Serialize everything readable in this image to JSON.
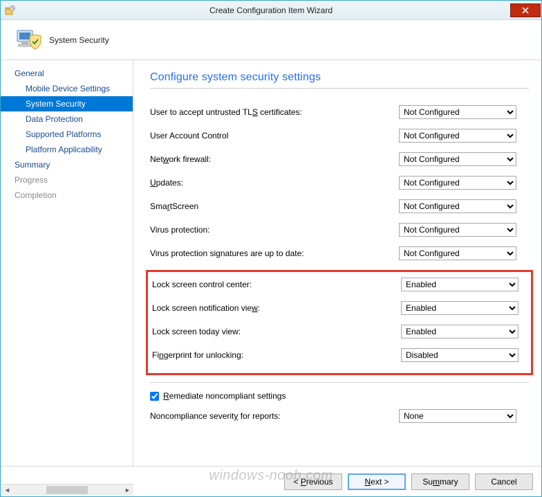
{
  "window": {
    "title": "Create Configuration Item Wizard"
  },
  "header": {
    "label": "System Security"
  },
  "sidebar": {
    "items": [
      {
        "label": "General",
        "level": 1,
        "selected": false,
        "muted": false
      },
      {
        "label": "Mobile Device Settings",
        "level": 2,
        "selected": false,
        "muted": false
      },
      {
        "label": "System Security",
        "level": 2,
        "selected": true,
        "muted": false
      },
      {
        "label": "Data Protection",
        "level": 2,
        "selected": false,
        "muted": false
      },
      {
        "label": "Supported Platforms",
        "level": 2,
        "selected": false,
        "muted": false
      },
      {
        "label": "Platform Applicability",
        "level": 2,
        "selected": false,
        "muted": false
      },
      {
        "label": "Summary",
        "level": 1,
        "selected": false,
        "muted": false
      },
      {
        "label": "Progress",
        "level": 1,
        "selected": false,
        "muted": true
      },
      {
        "label": "Completion",
        "level": 1,
        "selected": false,
        "muted": true
      }
    ]
  },
  "content": {
    "heading": "Configure system security settings",
    "settings_top": [
      {
        "label_html": "User to accept untrusted TL<u>S</u> certificates:",
        "value": "Not Configured"
      },
      {
        "label_html": "User Account Control",
        "value": "Not Configured"
      },
      {
        "label_html": "Net<u>w</u>ork firewall:",
        "value": "Not Configured"
      },
      {
        "label_html": "<u>U</u>pdates:",
        "value": "Not Configured"
      },
      {
        "label_html": "Sma<u>r</u>tScreen",
        "value": "Not Configured"
      },
      {
        "label_html": "Virus protection:",
        "value": "Not Configured"
      },
      {
        "label_html": "Virus protection signatures are up to date:",
        "value": "Not Configured"
      }
    ],
    "settings_highlight": [
      {
        "label_html": "Lock screen control center:",
        "value": "Enabled"
      },
      {
        "label_html": "Lock screen notification vie<u>w</u>:",
        "value": "Enabled"
      },
      {
        "label_html": "Lock screen today view:",
        "value": "Enabled"
      },
      {
        "label_html": "Fi<u>n</u>gerprint for unlocking:",
        "value": "Disabled"
      }
    ],
    "remediate": {
      "label_html": "<u>R</u>emediate noncompliant settings",
      "checked": true
    },
    "noncompliance": {
      "label_html": "Noncompliance severit<u>y</u> for reports:",
      "value": "None"
    }
  },
  "footer": {
    "previous": "< Previous",
    "next": "Next >",
    "summary": "Summary",
    "cancel": "Cancel"
  },
  "watermark": "windows-noob.com",
  "select_options": [
    "Not Configured",
    "Enabled",
    "Disabled",
    "None"
  ]
}
